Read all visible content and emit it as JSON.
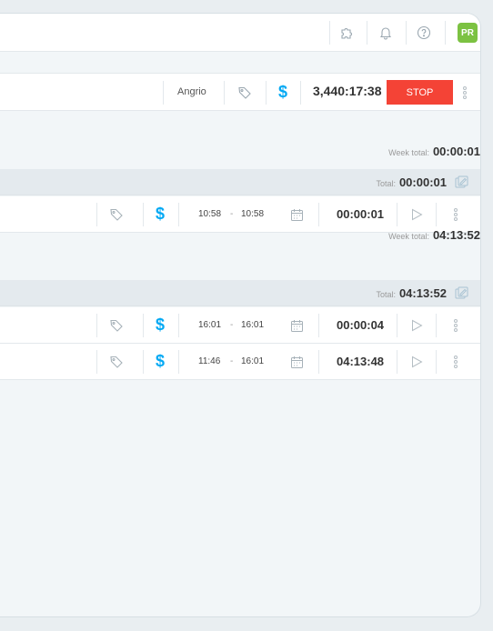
{
  "topbar": {
    "icons": [
      "puzzle-icon",
      "bell-icon",
      "help-icon"
    ],
    "avatar_initials": "PR"
  },
  "timer": {
    "project": "Angrio",
    "elapsed": "3,440:17:38",
    "stop_label": "STOP"
  },
  "weeks": [
    {
      "week_total_label": "Week total:",
      "week_total": "00:00:01",
      "days": [
        {
          "total_label": "Total:",
          "total": "00:00:01",
          "entries": [
            {
              "start": "10:58",
              "end": "10:58",
              "duration": "00:00:01"
            }
          ]
        }
      ]
    },
    {
      "week_total_label": "Week total:",
      "week_total": "04:13:52",
      "days": [
        {
          "total_label": "Total:",
          "total": "04:13:52",
          "entries": [
            {
              "start": "16:01",
              "end": "16:01",
              "duration": "00:00:04"
            },
            {
              "start": "11:46",
              "end": "16:01",
              "duration": "04:13:48"
            }
          ]
        }
      ]
    }
  ],
  "colors": {
    "accent": "#03a9f4",
    "stop": "#f44336",
    "avatar": "#7cc242",
    "background": "#f2f6f8"
  },
  "range_separator": "-",
  "billable_symbol": "$"
}
